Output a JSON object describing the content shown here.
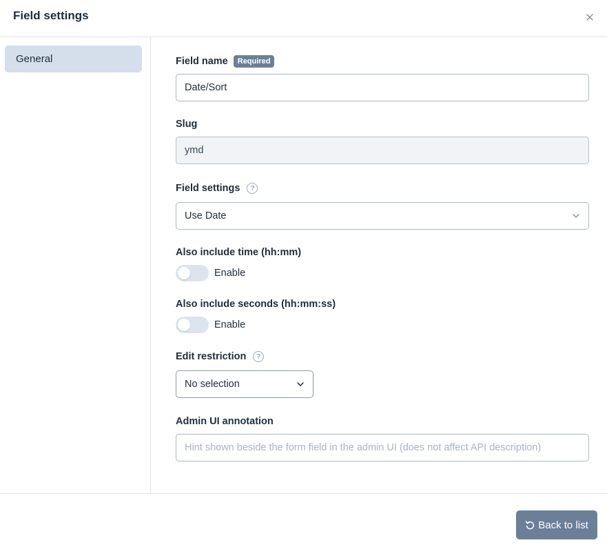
{
  "header": {
    "title": "Field settings"
  },
  "sidebar": {
    "items": [
      {
        "label": "General"
      }
    ]
  },
  "form": {
    "field_name": {
      "label": "Field name",
      "badge": "Required",
      "value": "Date/Sort"
    },
    "slug": {
      "label": "Slug",
      "value": "ymd"
    },
    "field_settings": {
      "label": "Field settings",
      "value": "Use Date"
    },
    "include_time": {
      "label": "Also include time (hh:mm)",
      "toggle_label": "Enable",
      "enabled": false
    },
    "include_seconds": {
      "label": "Also include seconds (hh:mm:ss)",
      "toggle_label": "Enable",
      "enabled": false
    },
    "edit_restriction": {
      "label": "Edit restriction",
      "value": "No selection"
    },
    "annotation": {
      "label": "Admin UI annotation",
      "placeholder": "Hint shown beside the form field in the admin UI (does not affect API description)"
    }
  },
  "footer": {
    "back_label": "Back to list"
  },
  "colors": {
    "accent": "#6b7f99",
    "sidebar_active": "#d4dfeb"
  }
}
